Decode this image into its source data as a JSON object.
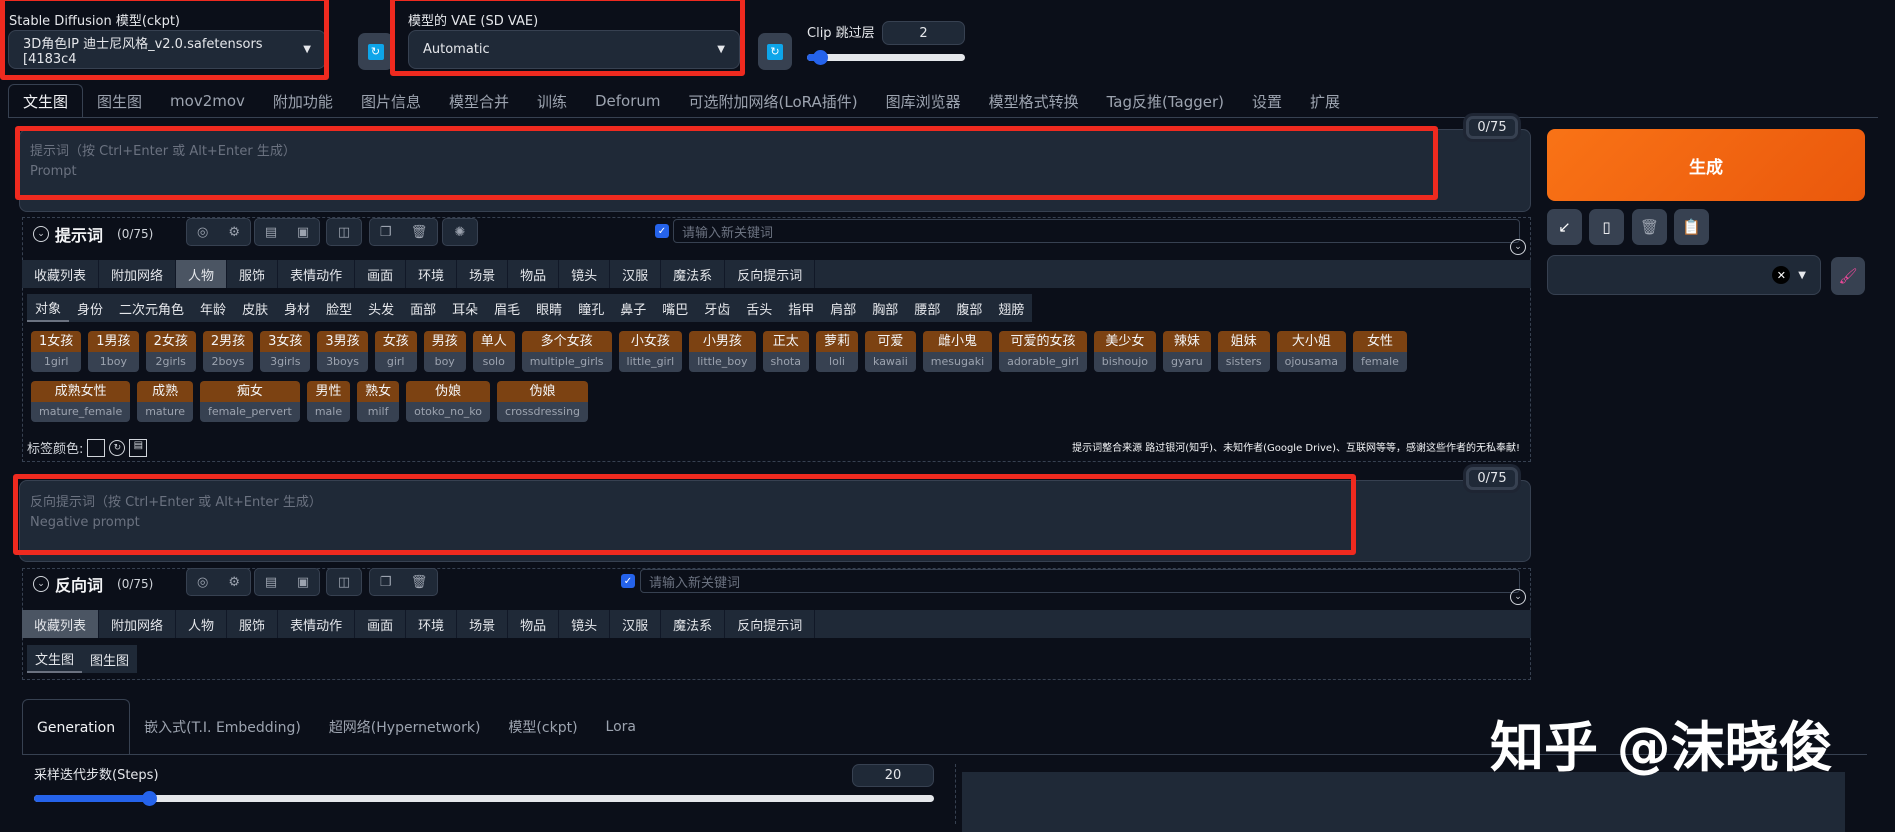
{
  "top": {
    "model_label": "Stable Diffusion 模型(ckpt)",
    "model_value": "3D角色IP 迪士尼风格_v2.0.safetensors [4183c4",
    "vae_label": "模型的 VAE (SD VAE)",
    "vae_value": "Automatic",
    "clip_label": "Clip 跳过层",
    "clip_value": "2",
    "clip_fraction": 0.1
  },
  "main_tabs": [
    "文生图",
    "图生图",
    "mov2mov",
    "附加功能",
    "图片信息",
    "模型合并",
    "训练",
    "Deforum",
    "可选附加网络(LoRA插件)",
    "图库浏览器",
    "模型格式转换",
    "Tag反推(Tagger)",
    "设置",
    "扩展"
  ],
  "prompt": {
    "placeholder1": "提示词（按 Ctrl+Enter 或 Alt+Enter 生成）",
    "placeholder2": "Prompt",
    "counter": "0/75",
    "title": "提示词",
    "count": "(0/75)",
    "keyword_placeholder": "请输入新关键词"
  },
  "negative": {
    "placeholder1": "反向提示词（按 Ctrl+Enter 或 Alt+Enter 生成）",
    "placeholder2": "Negative prompt",
    "counter": "0/75",
    "title": "反向词",
    "count": "(0/75)",
    "keyword_placeholder": "请输入新关键词"
  },
  "generate_label": "生成",
  "categories": [
    "收藏列表",
    "附加网络",
    "人物",
    "服饰",
    "表情动作",
    "画面",
    "环境",
    "场景",
    "物品",
    "镜头",
    "汉服",
    "魔法系",
    "反向提示词"
  ],
  "subcategories": [
    "对象",
    "身份",
    "二次元角色",
    "年龄",
    "皮肤",
    "身材",
    "脸型",
    "头发",
    "面部",
    "耳朵",
    "眉毛",
    "眼睛",
    "瞳孔",
    "鼻子",
    "嘴巴",
    "牙齿",
    "舌头",
    "指甲",
    "肩部",
    "胸部",
    "腰部",
    "腹部",
    "翅膀"
  ],
  "tags_row1": [
    [
      "1女孩",
      "1girl"
    ],
    [
      "1男孩",
      "1boy"
    ],
    [
      "2女孩",
      "2girls"
    ],
    [
      "2男孩",
      "2boys"
    ],
    [
      "3女孩",
      "3girls"
    ],
    [
      "3男孩",
      "3boys"
    ],
    [
      "女孩",
      "girl"
    ],
    [
      "男孩",
      "boy"
    ],
    [
      "单人",
      "solo"
    ],
    [
      "多个女孩",
      "multiple_girls"
    ],
    [
      "小女孩",
      "little_girl"
    ],
    [
      "小男孩",
      "little_boy"
    ],
    [
      "正太",
      "shota"
    ],
    [
      "萝莉",
      "loli"
    ],
    [
      "可爱",
      "kawaii"
    ],
    [
      "雌小鬼",
      "mesugaki"
    ],
    [
      "可爱的女孩",
      "adorable_girl"
    ],
    [
      "美少女",
      "bishoujo"
    ],
    [
      "辣妹",
      "gyaru"
    ],
    [
      "姐妹",
      "sisters"
    ],
    [
      "大小姐",
      "ojousama"
    ],
    [
      "女性",
      "female"
    ]
  ],
  "tags_row2": [
    [
      "成熟女性",
      "mature_female"
    ],
    [
      "成熟",
      "mature"
    ],
    [
      "痴女",
      "female_pervert"
    ],
    [
      "男性",
      "male"
    ],
    [
      "熟女",
      "milf"
    ],
    [
      "伪娘",
      "otoko_no_ko"
    ],
    [
      "伪娘",
      "crossdressing"
    ]
  ],
  "tag_color_label": "标签颜色:",
  "credits": "提示词整合来源 路过银河(知乎)、未知作者(Google Drive)、互联网等等，感谢这些作者的无私奉献!",
  "neg_sub": [
    "文生图",
    "图生图"
  ],
  "bottom_tabs": [
    "Generation",
    "嵌入式(T.I. Embedding)",
    "超网络(Hypernetwork)",
    "模型(ckpt)",
    "Lora"
  ],
  "steps": {
    "label": "采样迭代步数(Steps)",
    "value": "20",
    "min": 1,
    "max": 150
  },
  "watermark": "知乎 @沫晓俊"
}
